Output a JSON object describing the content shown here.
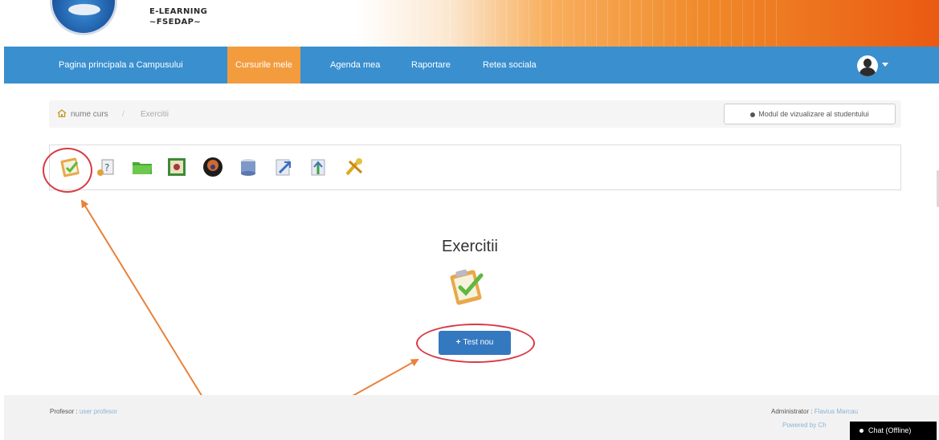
{
  "header": {
    "logo_line1": "E-LEARNING",
    "logo_line2": "~FSEDAP~"
  },
  "nav": {
    "items": [
      {
        "label": "Pagina principala a Campusului"
      },
      {
        "label": "Cursurile mele",
        "active": true
      },
      {
        "label": "Agenda mea"
      },
      {
        "label": "Raportare"
      },
      {
        "label": "Retea sociala"
      }
    ],
    "user_icon": "user-avatar-icon"
  },
  "breadcrumb": {
    "course": "nume curs",
    "separator": "/",
    "current": "Exercitii",
    "student_view_label": "Modul de vizualizare al studentului"
  },
  "toolbar": {
    "tools": [
      {
        "icon": "new-test-icon",
        "highlighted": true
      },
      {
        "icon": "question-pool-icon"
      },
      {
        "icon": "folder-icon"
      },
      {
        "icon": "import-icon"
      },
      {
        "icon": "hotpotatoes-icon"
      },
      {
        "icon": "database-icon"
      },
      {
        "icon": "export-icon"
      },
      {
        "icon": "upload-icon"
      },
      {
        "icon": "tools-icon"
      }
    ]
  },
  "main": {
    "title": "Exercitii",
    "icon": "exercises-clipboard-icon",
    "new_test_label": "Test nou"
  },
  "footer": {
    "left_label": "Profesor : ",
    "left_link": "user profesor",
    "right_label": "Administrator : ",
    "right_link": "Flavius Marcau",
    "powered_by": "Powered by Ch",
    "chat_label": "Chat (Offline)"
  },
  "colors": {
    "nav_blue": "#3a8fcf",
    "nav_active_orange": "#f39c3e",
    "button_blue": "#3478c0",
    "highlight_red": "#d83a44",
    "arrow_orange": "#e8823a"
  }
}
